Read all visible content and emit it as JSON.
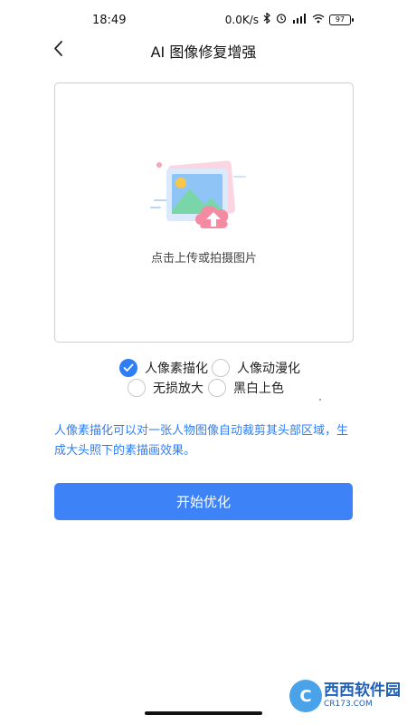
{
  "status_bar": {
    "time": "18:49",
    "network_speed": "0.0K/s",
    "battery": "97"
  },
  "header": {
    "title": "AI 图像修复增强"
  },
  "upload": {
    "hint": "点击上传或拍摄图片"
  },
  "options": [
    {
      "label": "人像素描化",
      "checked": true
    },
    {
      "label": "人像动漫化",
      "checked": false
    },
    {
      "label": "无损放大",
      "checked": false
    },
    {
      "label": "黑白上色",
      "checked": false
    }
  ],
  "description": "人像素描化可以对一张人物图像自动裁剪其头部区域，生成大头照下的素描画效果。",
  "primary_button": {
    "label": "开始优化"
  },
  "watermark": {
    "brand": "西西软件园",
    "domain": "CR173.COM"
  },
  "colors": {
    "accent": "#2f7ef6",
    "button": "#3d82f7"
  }
}
